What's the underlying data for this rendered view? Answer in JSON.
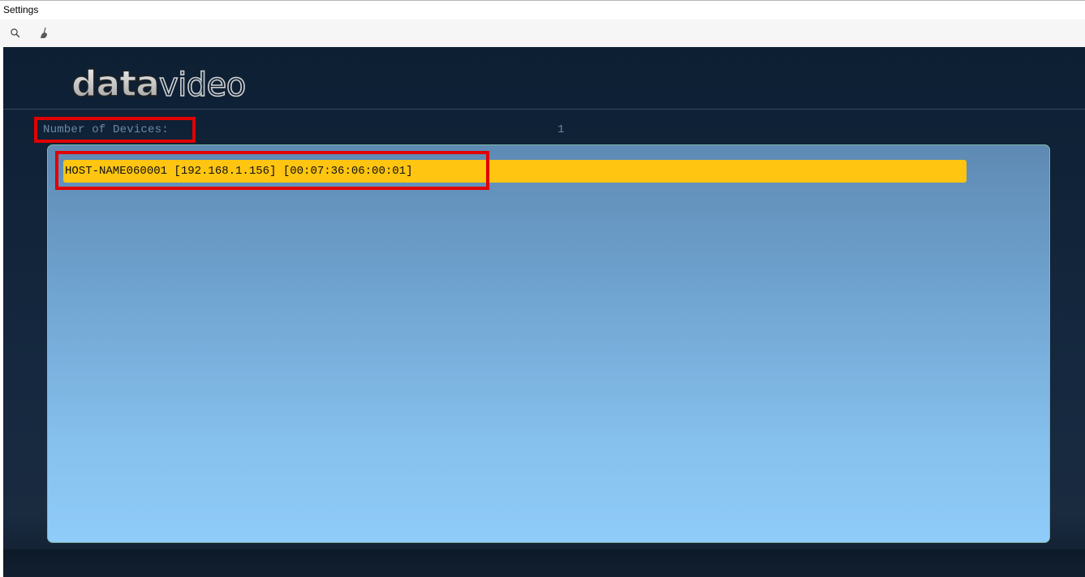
{
  "window": {
    "title": "Settings"
  },
  "toolbar": {
    "items": [
      {
        "icon": "search-icon"
      },
      {
        "icon": "broom-icon"
      }
    ]
  },
  "app": {
    "logo_text": "datavideo",
    "devices_label": "Number of Devices:",
    "devices_count": "1",
    "devices": [
      {
        "label": "HOST-NAME060001 [192.168.1.156] [00:07:36:06:00:01]"
      }
    ]
  },
  "colors": {
    "background": "#0d1f33",
    "panel_top": "#5e8ab3",
    "panel_bottom": "#90ccfa",
    "selected_row": "#ffc510",
    "highlight": "#e00000",
    "label": "#6b8aa6"
  }
}
